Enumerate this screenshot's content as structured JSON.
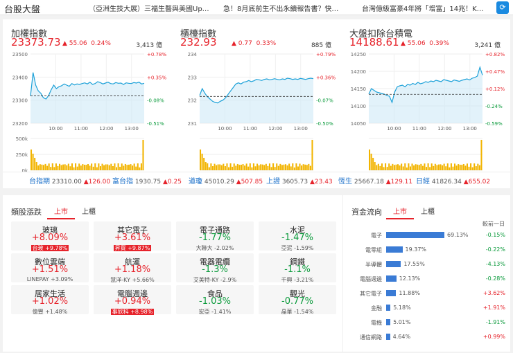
{
  "header": {
    "title": "台股大盤",
    "ticker": [
      "（亞洲生技大展）三福生醫與美國Up…",
      "急！8月底前生不出永續報告書？快…",
      "台灣億級富豪4年將「增富」14兆！K…"
    ],
    "refresh_icon": "refresh-icon"
  },
  "indices": [
    {
      "name": "加權指數",
      "value": "23373.73",
      "arrow": "▲",
      "change": "55.06",
      "pct": "0.24%",
      "volume": "3,413 億",
      "yticks": [
        "23500",
        "23400",
        "23300",
        "23200"
      ],
      "yrange": [
        23200,
        23500
      ],
      "ref": 23318.67,
      "pticks": [
        "+0.78%",
        "+0.35%",
        "-0.08%",
        "-0.51%"
      ],
      "vol_ticks": [
        "500k",
        "250k",
        "0k"
      ],
      "times": [
        "10:00",
        "11:00",
        "12:00",
        "13:00"
      ],
      "series": [
        23318,
        23420,
        23365,
        23340,
        23330,
        23310,
        23305,
        23320,
        23345,
        23365,
        23350,
        23358,
        23362,
        23370,
        23365,
        23360,
        23372,
        23366,
        23370,
        23368,
        23372,
        23375,
        23370,
        23378,
        23368,
        23372,
        23380,
        23376,
        23370,
        23374,
        23378,
        23372,
        23370,
        23376,
        23373,
        23374,
        23368,
        23375,
        23373,
        23372,
        23376,
        23374,
        23378,
        23370,
        23373
      ]
    },
    {
      "name": "櫃檯指數",
      "value": "232.93",
      "arrow": "▲",
      "change": "0.77",
      "pct": "0.33%",
      "volume": "885 億",
      "yticks": [
        "234",
        "233",
        "232",
        "231"
      ],
      "yrange": [
        231,
        234
      ],
      "ref": 232.16,
      "pticks": [
        "+0.79%",
        "+0.36%",
        "-0.07%",
        "-0.50%"
      ],
      "vol_ticks": [
        "",
        "",
        ""
      ],
      "times": [
        "10:00",
        "11:00",
        "12:00",
        "13:00"
      ],
      "series": [
        232.2,
        232.5,
        232.3,
        232.15,
        232.05,
        231.95,
        231.9,
        231.88,
        231.95,
        232.0,
        232.1,
        232.25,
        232.4,
        232.55,
        232.7,
        232.75,
        232.7,
        232.78,
        232.8,
        232.85,
        232.8,
        232.84,
        232.9,
        232.88,
        232.85,
        232.9,
        232.92,
        232.88,
        232.9,
        232.93,
        232.9,
        232.88,
        232.92,
        232.9,
        232.95,
        232.93,
        232.9,
        232.92,
        232.9,
        232.94,
        232.92,
        232.9,
        232.93,
        232.95,
        232.93
      ]
    },
    {
      "name": "大盤扣除台積電",
      "value": "14188.61",
      "arrow": "▲",
      "change": "55.06",
      "pct": "0.39%",
      "volume": "3,241 億",
      "yticks": [
        "14250",
        "14200",
        "14150",
        "14100",
        "14050"
      ],
      "yrange": [
        14050,
        14250
      ],
      "ref": 14133.55,
      "pticks": [
        "+0.82%",
        "+0.47%",
        "+0.12%",
        "-0.24%",
        "-0.59%"
      ],
      "vol_ticks": [
        "",
        "",
        ""
      ],
      "times": [
        "10:00",
        "11:00",
        "12:00",
        "13:00"
      ],
      "series": [
        14134,
        14150,
        14145,
        14140,
        14138,
        14136,
        14134,
        14130,
        14128,
        14110,
        14140,
        14155,
        14158,
        14160,
        14155,
        14162,
        14160,
        14165,
        14162,
        14168,
        14164,
        14166,
        14170,
        14168,
        14172,
        14170,
        14174,
        14172,
        14170,
        14176,
        14174,
        14172,
        14170,
        14175,
        14173,
        14171,
        14174,
        14176,
        14178,
        14175,
        14180,
        14182,
        14186,
        14212,
        14189
      ]
    }
  ],
  "strip": [
    {
      "name": "台指期",
      "value": "23310.00",
      "arrow": "▲",
      "chg": "126.00"
    },
    {
      "name": "富台指",
      "value": "1930.75",
      "arrow": "▲",
      "chg": "0.25"
    },
    {
      "name": "道瓊",
      "value": "45010.29",
      "arrow": "▲",
      "chg": "507.85"
    },
    {
      "name": "上證",
      "value": "3605.73",
      "arrow": "▲",
      "chg": "23.43"
    },
    {
      "name": "恆生",
      "value": "25667.18",
      "arrow": "▲",
      "chg": "129.11"
    },
    {
      "name": "日經",
      "value": "41826.34",
      "arrow": "▲",
      "chg": "655.02"
    }
  ],
  "sectors": {
    "title": "類股漲跌",
    "tabs": [
      "上市",
      "上櫃"
    ],
    "items": [
      {
        "name": "玻璃",
        "pct": "+8.09%",
        "dir": "up",
        "sub_name": "台玻",
        "sub_pct": "+9.78%",
        "hl": true
      },
      {
        "name": "其它電子",
        "pct": "+3.61%",
        "dir": "up",
        "sub_name": "昇貿",
        "sub_pct": "+9.87%",
        "hl": true
      },
      {
        "name": "電子通路",
        "pct": "-1.77%",
        "dir": "dn",
        "sub_name": "大聯大",
        "sub_pct": "-2.02%",
        "hl": false
      },
      {
        "name": "水泥",
        "pct": "-1.47%",
        "dir": "dn",
        "sub_name": "亞泥",
        "sub_pct": "-1.59%",
        "hl": false
      },
      {
        "name": "數位雲端",
        "pct": "+1.51%",
        "dir": "up",
        "sub_name": "LINEPAY",
        "sub_pct": "+3.09%",
        "hl": false
      },
      {
        "name": "航運",
        "pct": "+1.18%",
        "dir": "up",
        "sub_name": "慧洋-KY",
        "sub_pct": "+5.66%",
        "hl": false
      },
      {
        "name": "電器電纜",
        "pct": "-1.3%",
        "dir": "dn",
        "sub_name": "艾美特-KY",
        "sub_pct": "-2.9%",
        "hl": false
      },
      {
        "name": "鋼鐵",
        "pct": "-1.1%",
        "dir": "dn",
        "sub_name": "千興",
        "sub_pct": "-3.21%",
        "hl": false
      },
      {
        "name": "居家生活",
        "pct": "+1.02%",
        "dir": "up",
        "sub_name": "億豐",
        "sub_pct": "+1.48%",
        "hl": false
      },
      {
        "name": "電腦週邊",
        "pct": "+0.94%",
        "dir": "up",
        "sub_name": "事欣科",
        "sub_pct": "+8.98%",
        "hl": true
      },
      {
        "name": "食品",
        "pct": "-1.03%",
        "dir": "dn",
        "sub_name": "宏亞",
        "sub_pct": "-1.41%",
        "hl": false
      },
      {
        "name": "觀光",
        "pct": "-0.77%",
        "dir": "dn",
        "sub_name": "晶華",
        "sub_pct": "-1.54%",
        "hl": false
      }
    ]
  },
  "flow": {
    "title": "資金流向",
    "tabs": [
      "上市",
      "上櫃"
    ],
    "compare_label": "較前一日",
    "rows": [
      {
        "name": "電子",
        "share": 69.13,
        "share_text": "69.13%",
        "delta": "-0.15%",
        "dir": "dn"
      },
      {
        "name": "電零組",
        "share": 19.37,
        "share_text": "19.37%",
        "delta": "-0.22%",
        "dir": "dn"
      },
      {
        "name": "半導體",
        "share": 17.55,
        "share_text": "17.55%",
        "delta": "-4.13%",
        "dir": "dn"
      },
      {
        "name": "電腦週邊",
        "share": 12.13,
        "share_text": "12.13%",
        "delta": "-0.28%",
        "dir": "dn"
      },
      {
        "name": "其它電子",
        "share": 11.88,
        "share_text": "11.88%",
        "delta": "+3.62%",
        "dir": "up"
      },
      {
        "name": "金融",
        "share": 5.18,
        "share_text": "5.18%",
        "delta": "+1.91%",
        "dir": "up"
      },
      {
        "name": "電機",
        "share": 5.01,
        "share_text": "5.01%",
        "delta": "-1.91%",
        "dir": "dn"
      },
      {
        "name": "通信網路",
        "share": 4.64,
        "share_text": "4.64%",
        "delta": "+0.99%",
        "dir": "up"
      }
    ]
  },
  "colors": {
    "up": "#e6232b",
    "down": "#0a9a3b",
    "line": "#1aa0d8",
    "area": "#cfeaf6",
    "volume": "#f2b400",
    "accent": "#1a8ae0"
  }
}
